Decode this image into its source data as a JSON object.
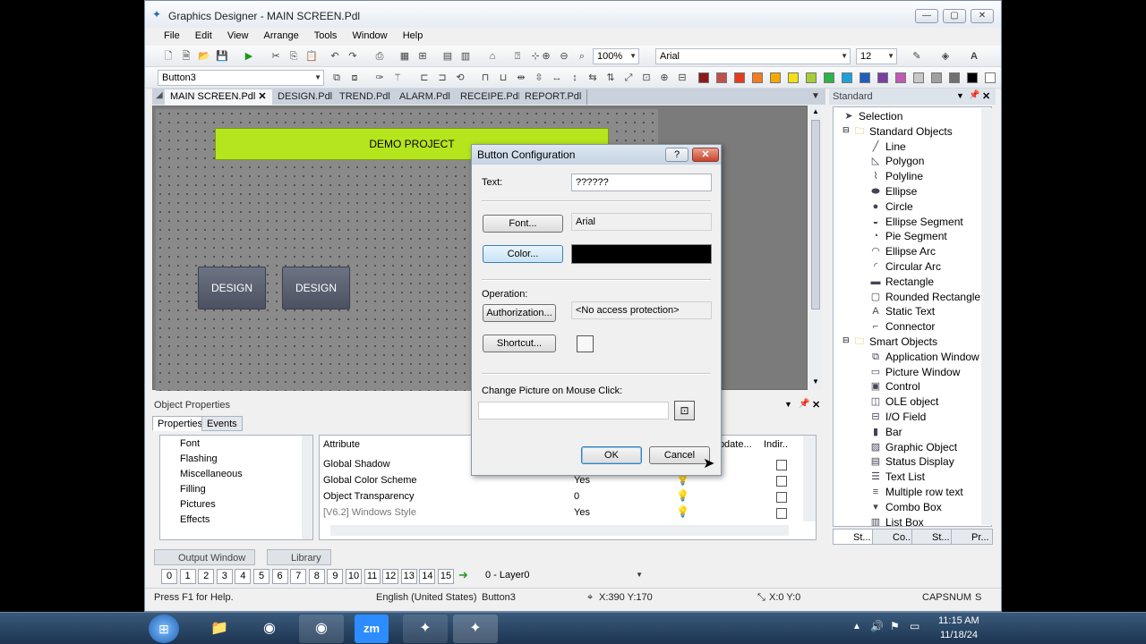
{
  "window": {
    "title": "Graphics Designer - MAIN SCREEN.Pdl"
  },
  "menu": [
    "File",
    "Edit",
    "View",
    "Arrange",
    "Tools",
    "Window",
    "Help"
  ],
  "toolbar": {
    "zoom": "100%",
    "font": "Arial",
    "font_size": "12",
    "object_selector": "Button3"
  },
  "palette": [
    "#8b1a1a",
    "#c0504d",
    "#e63a1f",
    "#f47b20",
    "#f6a800",
    "#f7e016",
    "#a6ce39",
    "#2db34a",
    "#1ea0dc",
    "#1f5dbf",
    "#7a3fa0",
    "#c05ab5",
    "#c8c8c8",
    "#a0a0a0",
    "#707070",
    "#000000",
    "#ffffff"
  ],
  "tabs": [
    "MAIN SCREEN.Pdl",
    "DESIGN.Pdl",
    "TREND.Pdl",
    "ALARM.Pdl",
    "RECEIPE.Pdl",
    "REPORT.Pdl"
  ],
  "canvas": {
    "banner": "DEMO PROJECT",
    "buttons": [
      "DESIGN",
      "DESIGN"
    ]
  },
  "object_properties": {
    "title": "Object Properties",
    "tabs": [
      "Properties",
      "Events"
    ],
    "tree": [
      "Font",
      "Flashing",
      "Miscellaneous",
      "Filling",
      "Pictures",
      "Effects"
    ],
    "columns": {
      "attribute": "Attribute",
      "update": "Update...",
      "indirect": "Indir.."
    },
    "rows": [
      {
        "attribute": "Global Shadow",
        "value": ""
      },
      {
        "attribute": "Global Color Scheme",
        "value": "Yes"
      },
      {
        "attribute": "Object Transparency",
        "value": "0"
      },
      {
        "attribute": "[V6.2] Windows Style",
        "value": "Yes"
      }
    ]
  },
  "bottom_tabs": [
    "Output Window",
    "Library"
  ],
  "layers": {
    "numbers": [
      "0",
      "1",
      "2",
      "3",
      "4",
      "5",
      "6",
      "7",
      "8",
      "9",
      "10",
      "11",
      "12",
      "13",
      "14",
      "15"
    ],
    "current": "0 - Layer0"
  },
  "status": {
    "help": "Press F1 for Help.",
    "language": "English (United States)",
    "object": "Button3",
    "position": "X:390 Y:170",
    "size": "X:0 Y:0",
    "caps": "CAPS",
    "num": "NUM",
    "s": "S"
  },
  "right_panel": {
    "title": "Standard",
    "items": [
      {
        "label": "Selection",
        "icon": "cursor-icon",
        "level": 1
      },
      {
        "label": "Standard Objects",
        "icon": "folder-icon",
        "level": 0
      },
      {
        "label": "Line",
        "icon": "line-icon",
        "level": 2
      },
      {
        "label": "Polygon",
        "icon": "polygon-icon",
        "level": 2
      },
      {
        "label": "Polyline",
        "icon": "polyline-icon",
        "level": 2
      },
      {
        "label": "Ellipse",
        "icon": "ellipse-icon",
        "level": 2
      },
      {
        "label": "Circle",
        "icon": "circle-icon",
        "level": 2
      },
      {
        "label": "Ellipse Segment",
        "icon": "ellipse-segment-icon",
        "level": 2
      },
      {
        "label": "Pie Segment",
        "icon": "pie-segment-icon",
        "level": 2
      },
      {
        "label": "Ellipse Arc",
        "icon": "ellipse-arc-icon",
        "level": 2
      },
      {
        "label": "Circular Arc",
        "icon": "circular-arc-icon",
        "level": 2
      },
      {
        "label": "Rectangle",
        "icon": "rectangle-icon",
        "level": 2
      },
      {
        "label": "Rounded Rectangle",
        "icon": "rounded-rectangle-icon",
        "level": 2
      },
      {
        "label": "Static Text",
        "icon": "text-icon",
        "level": 2
      },
      {
        "label": "Connector",
        "icon": "connector-icon",
        "level": 2
      },
      {
        "label": "Smart Objects",
        "icon": "folder-icon",
        "level": 0
      },
      {
        "label": "Application Window",
        "icon": "app-window-icon",
        "level": 2
      },
      {
        "label": "Picture Window",
        "icon": "picture-window-icon",
        "level": 2
      },
      {
        "label": "Control",
        "icon": "ocx-icon",
        "level": 2
      },
      {
        "label": "OLE object",
        "icon": "ole-icon",
        "level": 2
      },
      {
        "label": "I/O Field",
        "icon": "io-field-icon",
        "level": 2
      },
      {
        "label": "Bar",
        "icon": "bar-icon",
        "level": 2
      },
      {
        "label": "Graphic Object",
        "icon": "graphic-object-icon",
        "level": 2
      },
      {
        "label": "Status Display",
        "icon": "status-display-icon",
        "level": 2
      },
      {
        "label": "Text List",
        "icon": "text-list-icon",
        "level": 2
      },
      {
        "label": "Multiple row text",
        "icon": "multi-row-text-icon",
        "level": 2
      },
      {
        "label": "Combo Box",
        "icon": "combo-box-icon",
        "level": 2
      },
      {
        "label": "List Box",
        "icon": "list-box-icon",
        "level": 2
      }
    ],
    "bottom_tabs": [
      "St...",
      "Co...",
      "St...",
      "Pr..."
    ]
  },
  "dialog": {
    "title": "Button Configuration",
    "text_label": "Text:",
    "text_value": "??????",
    "font_button": "Font...",
    "font_value": "Arial",
    "color_button": "Color...",
    "color_value": "#000000",
    "operation_label": "Operation:",
    "auth_button": "Authorization...",
    "auth_value": "<No access protection>",
    "shortcut_button": "Shortcut...",
    "change_picture_label": "Change Picture on Mouse Click:",
    "ok": "OK",
    "cancel": "Cancel"
  },
  "taskbar": {
    "time": "11:15 AM",
    "date": "11/18/24"
  }
}
